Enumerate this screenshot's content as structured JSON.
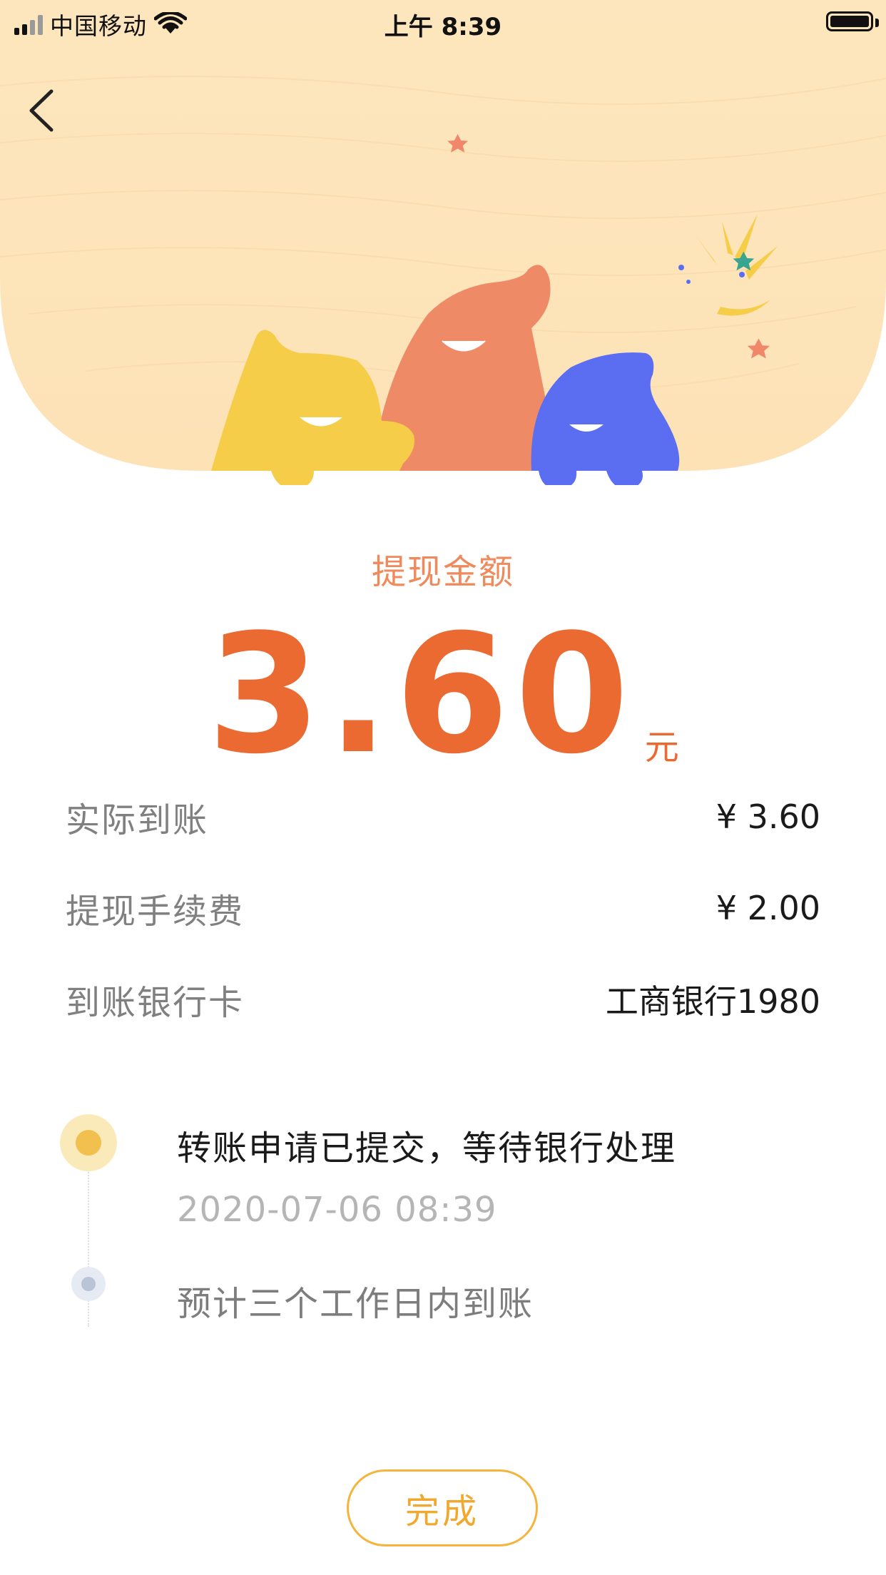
{
  "status_bar": {
    "carrier": "中国移动",
    "time": "上午 8:39"
  },
  "amount": {
    "title": "提现金额",
    "value": "3.60",
    "unit": "元"
  },
  "details": [
    {
      "label": "实际到账",
      "value": "¥ 3.60"
    },
    {
      "label": "提现手续费",
      "value": "¥ 2.00"
    },
    {
      "label": "到账银行卡",
      "value": "工商银行1980"
    }
  ],
  "timeline": {
    "submitted_title": "转账申请已提交，等待银行处理",
    "submitted_time": "2020-07-06 08:39",
    "pending_title": "预计三个工作日内到账"
  },
  "done_button": {
    "label": "完成"
  },
  "colors": {
    "accent_orange": "#ea6a32",
    "label_orange": "#ee8a5b",
    "button_gold": "#f0a92e",
    "mascot_yellow": "#f6cd48",
    "mascot_orange": "#ee8b66",
    "mascot_blue": "#5b6ef2"
  },
  "icons": {
    "back": "chevron-left-icon",
    "signal": "cellular-signal-icon",
    "wifi": "wifi-icon",
    "battery": "battery-icon",
    "illustration": "mascot-illustration"
  }
}
